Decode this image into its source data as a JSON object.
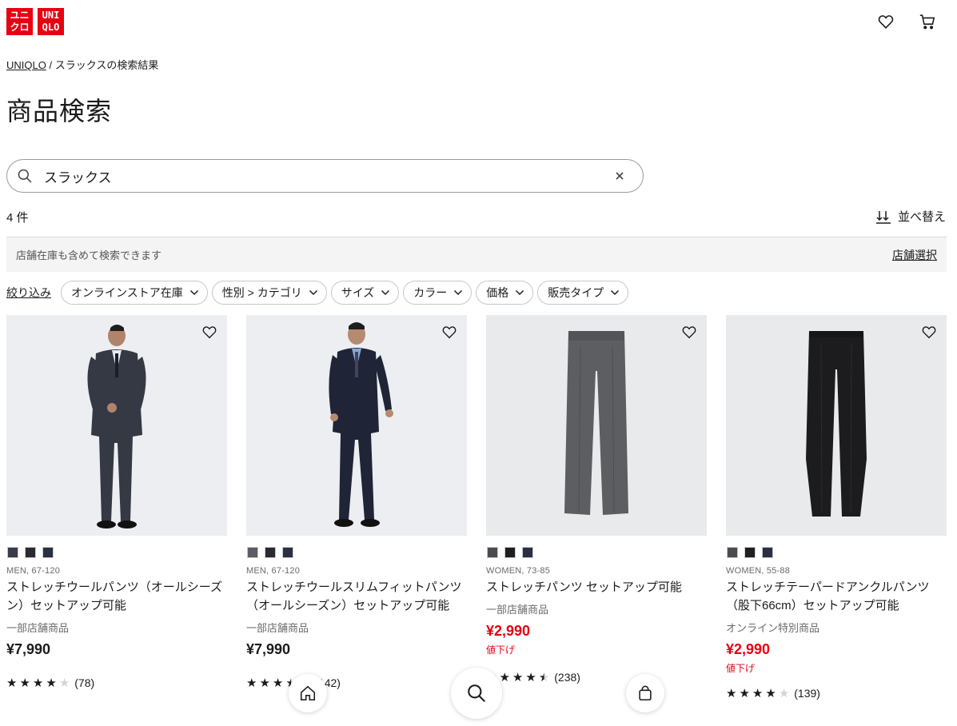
{
  "brand": {
    "logo_rows_left": [
      "ユニ",
      "クロ"
    ],
    "logo_rows_right": [
      "UNI",
      "QLO"
    ],
    "red": "#e60012"
  },
  "header": {
    "icons": [
      "heart-icon",
      "cart-icon"
    ]
  },
  "breadcrumb": {
    "home": "UNIQLO",
    "separator": "/",
    "current": "スラックスの検索結果"
  },
  "page_title": "商品検索",
  "search": {
    "value": "スラックス",
    "clear_label": "×"
  },
  "results": {
    "count": "4 件",
    "sort_label": "並べ替え"
  },
  "store_bar": {
    "text": "店舗在庫も含めて検索できます",
    "link": "店舗選択"
  },
  "filters": {
    "narrow_label": "絞り込み",
    "chips": [
      "オンラインストア在庫",
      "性別 > カテゴリ",
      "サイズ",
      "カラー",
      "価格",
      "販売タイプ"
    ]
  },
  "products": [
    {
      "swatches": [
        "#3a3d47",
        "#2a2b30",
        "#2b2f44"
      ],
      "gender": "MEN, 67-120",
      "name": "ストレッチウールパンツ（オールシーズン）セットアップ可能",
      "availability": "一部店舗商品",
      "price": "¥7,990",
      "sale": "",
      "rating": 4,
      "reviews": "(78)"
    },
    {
      "swatches": [
        "#5c5d62",
        "#2a2b30",
        "#2b2f44"
      ],
      "gender": "MEN, 67-120",
      "name": "ストレッチウールスリムフィットパンツ（オールシーズン）セットアップ可能",
      "availability": "一部店舗商品",
      "price": "¥7,990",
      "sale": "",
      "rating": 3.5,
      "reviews": "(142)"
    },
    {
      "swatches": [
        "#4b4c50",
        "#1f1f21",
        "#2b2f44"
      ],
      "gender": "WOMEN, 73-85",
      "name": "ストレッチパンツ セットアップ可能",
      "availability": "一部店舗商品",
      "price": "¥2,990",
      "sale": "値下げ",
      "rating": 4.5,
      "reviews": "(238)"
    },
    {
      "swatches": [
        "#4b4c50",
        "#1f1f21",
        "#2b2f44"
      ],
      "gender": "WOMEN, 55-88",
      "name": "ストレッチテーパードアンクルパンツ（股下66cm）セットアップ可能",
      "availability": "オンライン特別商品",
      "price": "¥2,990",
      "sale": "値下げ",
      "rating": 4,
      "reviews": "(139)"
    }
  ],
  "bottom_nav": [
    "home-icon",
    "search-icon",
    "account-icon"
  ]
}
